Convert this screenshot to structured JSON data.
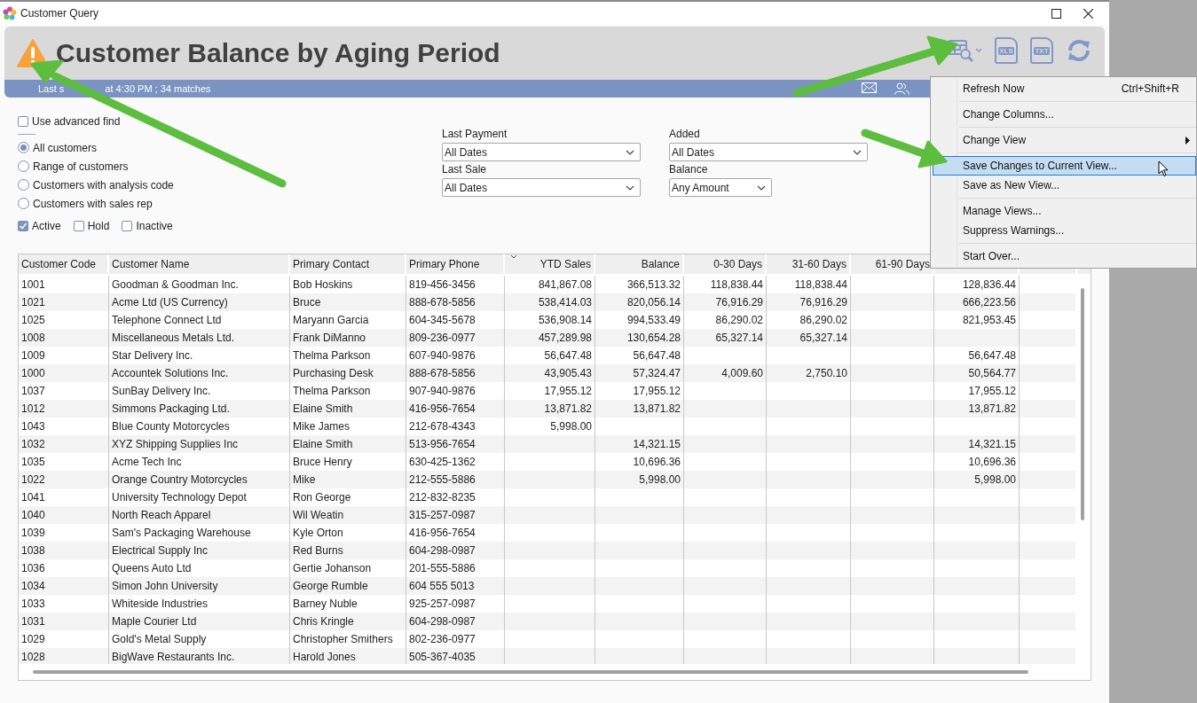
{
  "window": {
    "title": "Customer Query",
    "controls": [
      {
        "kind": "maximize"
      },
      {
        "kind": "close"
      }
    ]
  },
  "header": {
    "title": "Customer Balance by Aging Period",
    "toolbar": [
      {
        "kind": "grid-search",
        "has_dropdown": true
      },
      {
        "kind": "file",
        "label": "XLS"
      },
      {
        "kind": "file",
        "label": "TXT"
      },
      {
        "kind": "refresh"
      }
    ]
  },
  "status": {
    "parts": [
      "Last s",
      "at 4:30 PM ; 34 matches"
    ],
    "icons": [
      {
        "kind": "mail"
      },
      {
        "kind": "people"
      }
    ]
  },
  "filters": {
    "advanced_find": {
      "label": "Use advanced find",
      "checked": false
    },
    "scope": [
      {
        "label": "All customers",
        "selected": true
      },
      {
        "label": "Range of customers",
        "selected": false
      },
      {
        "label": "Customers with analysis code",
        "selected": false
      },
      {
        "label": "Customers with sales rep",
        "selected": false
      }
    ],
    "status_checks": [
      {
        "label": "Active",
        "checked": true
      },
      {
        "label": "Hold",
        "checked": false
      },
      {
        "label": "Inactive",
        "checked": false
      }
    ],
    "dropdowns": [
      {
        "label": "Last Payment",
        "value": "All Dates"
      },
      {
        "label": "Added",
        "value": "All Dates"
      },
      {
        "label": "Last Sale",
        "value": "All Dates"
      },
      {
        "label": "Balance",
        "value": "Any Amount"
      }
    ]
  },
  "table": {
    "columns": [
      {
        "label": "Customer Code",
        "kind": "text"
      },
      {
        "label": "Customer Name",
        "kind": "text"
      },
      {
        "label": "Primary Contact",
        "kind": "text"
      },
      {
        "label": "Primary Phone",
        "kind": "text"
      },
      {
        "label": "YTD Sales",
        "kind": "number",
        "sorted": true
      },
      {
        "label": "Balance",
        "kind": "number"
      },
      {
        "label": "0-30 Days",
        "kind": "number"
      },
      {
        "label": "31-60 Days",
        "kind": "number"
      },
      {
        "label": "61-90 Days",
        "kind": "number"
      },
      {
        "kind": "number"
      }
    ],
    "rows": [
      [
        "1001",
        "Goodman & Goodman Inc.",
        "Bob Hoskins",
        "819-456-3456",
        "841,867.08",
        "366,513.32",
        "118,838.44",
        "118,838.44",
        null,
        "128,836.44"
      ],
      [
        "1021",
        "Acme Ltd (US Currency)",
        "Bruce",
        "888-678-5856",
        "538,414.03",
        "820,056.14",
        "76,916.29",
        "76,916.29",
        null,
        "666,223.56"
      ],
      [
        "1025",
        "Telephone Connect Ltd",
        "Maryann Garcia",
        "604-345-5678",
        "536,908.14",
        "994,533.49",
        "86,290.02",
        "86,290.02",
        null,
        "821,953.45"
      ],
      [
        "1008",
        "Miscellaneous Metals Ltd.",
        "Frank DiManno",
        "809-236-0977",
        "457,289.98",
        "130,654.28",
        "65,327.14",
        "65,327.14",
        null,
        null
      ],
      [
        "1009",
        "Star Delivery Inc.",
        "Thelma Parkson",
        "607-940-9876",
        "56,647.48",
        "56,647.48",
        null,
        null,
        null,
        "56,647.48"
      ],
      [
        "1000",
        "Accountek Solutions Inc.",
        "Purchasing Desk",
        "888-678-5856",
        "43,905.43",
        "57,324.47",
        "4,009.60",
        "2,750.10",
        null,
        "50,564.77"
      ],
      [
        "1037",
        "SunBay Delivery Inc.",
        "Thelma Parkson",
        "907-940-9876",
        "17,955.12",
        "17,955.12",
        null,
        null,
        null,
        "17,955.12"
      ],
      [
        "1012",
        "Simmons Packaging Ltd.",
        "Elaine Smith",
        "416-956-7654",
        "13,871.82",
        "13,871.82",
        null,
        null,
        null,
        "13,871.82"
      ],
      [
        "1043",
        "Blue County Motorcycles",
        "Mike James",
        "212-678-4343",
        "5,998.00",
        null,
        null,
        null,
        null,
        null
      ],
      [
        "1032",
        "XYZ Shipping Supplies Inc",
        "Elaine Smith",
        "513-956-7654",
        null,
        "14,321.15",
        null,
        null,
        null,
        "14,321.15"
      ],
      [
        "1035",
        "Acme Tech Inc",
        "Bruce Henry",
        "630-425-1362",
        null,
        "10,696.36",
        null,
        null,
        null,
        "10,696.36"
      ],
      [
        "1022",
        "Orange Country Motorcycles",
        "Mike",
        "212-555-5886",
        null,
        "5,998.00",
        null,
        null,
        null,
        "5,998.00"
      ],
      [
        "1041",
        "University Technology Depot",
        "Ron George",
        "212-832-8235",
        null,
        null,
        null,
        null,
        null,
        null
      ],
      [
        "1040",
        "North Reach Apparel",
        "Wil Weatin",
        "315-257-0987",
        null,
        null,
        null,
        null,
        null,
        null
      ],
      [
        "1039",
        "Sam's Packaging Warehouse",
        "Kyle Orton",
        "416-956-7654",
        null,
        null,
        null,
        null,
        null,
        null
      ],
      [
        "1038",
        "Electrical Supply Inc",
        "Red Burns",
        "604-298-0987",
        null,
        null,
        null,
        null,
        null,
        null
      ],
      [
        "1036",
        "Queens Auto Ltd",
        "Gertie Johanson",
        "201-555-5886",
        null,
        null,
        null,
        null,
        null,
        null
      ],
      [
        "1034",
        "Simon John University",
        "George Rumble",
        "604 555 5013",
        null,
        null,
        null,
        null,
        null,
        null
      ],
      [
        "1033",
        "Whiteside Industries",
        "Barney Nuble",
        "925-257-0987",
        null,
        null,
        null,
        null,
        null,
        null
      ],
      [
        "1031",
        "Maple Courier Ltd",
        "Chris Kringle",
        "604-298-0987",
        null,
        null,
        null,
        null,
        null,
        null
      ],
      [
        "1029",
        "Gold's Metal Supply",
        "Christopher Smithers",
        "802-236-0977",
        null,
        null,
        null,
        null,
        null,
        null
      ],
      [
        "1028",
        "BigWave Restaurants Inc.",
        "Harold Jones",
        "505-367-4035",
        null,
        null,
        null,
        null,
        null,
        null
      ]
    ]
  },
  "menu": {
    "groups": [
      [
        {
          "label": "Refresh Now",
          "shortcut": "Ctrl+Shift+R",
          "selected": false
        }
      ],
      [
        {
          "label": "Change Columns...",
          "selected": false
        }
      ],
      [
        {
          "label": "Change View",
          "submenu": true,
          "selected": false
        }
      ],
      [
        {
          "label": "Save Changes to Current View...",
          "selected": true
        },
        {
          "label": "Save as New View...",
          "selected": false
        }
      ],
      [
        {
          "label": "Manage Views...",
          "selected": false
        },
        {
          "label": "Suppress Warnings...",
          "selected": false
        }
      ],
      [
        {
          "label": "Start Over...",
          "selected": false
        }
      ]
    ]
  },
  "annotations": [
    {
      "kind": "arrow"
    },
    {
      "kind": "arrow"
    },
    {
      "kind": "arrow"
    }
  ]
}
